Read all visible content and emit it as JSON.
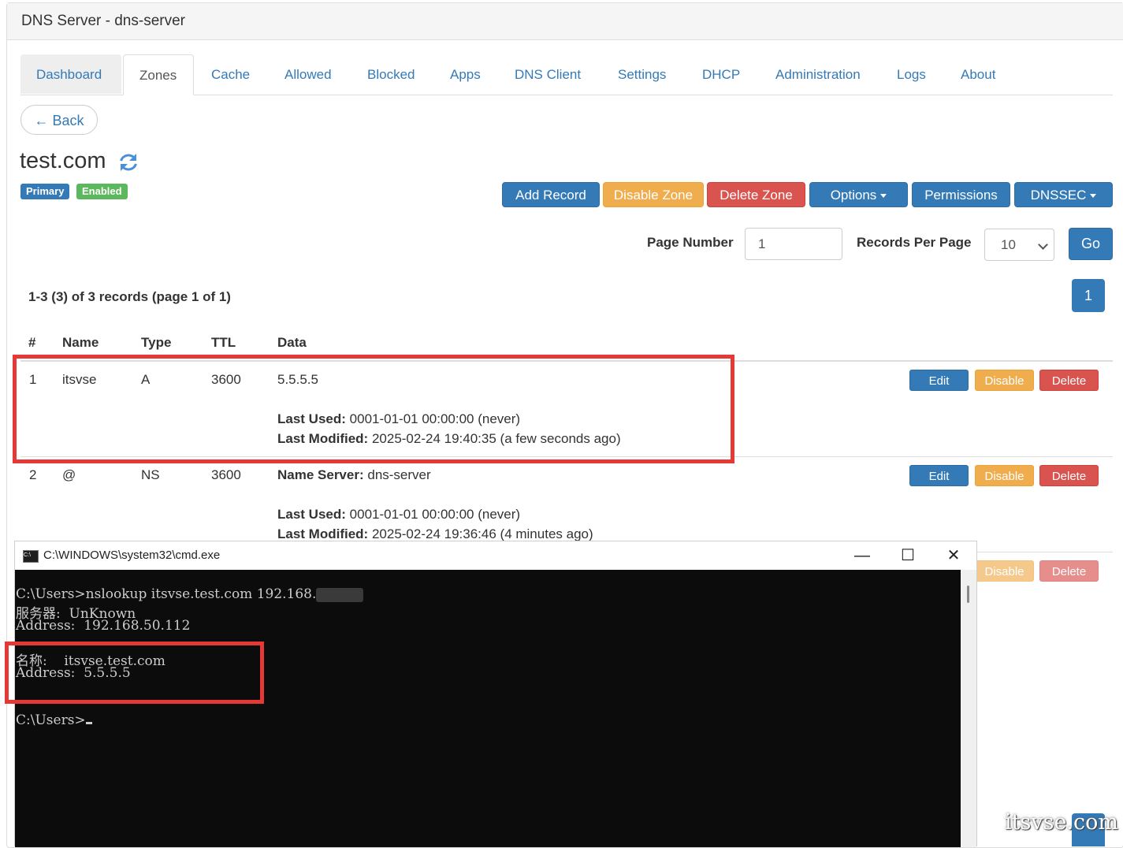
{
  "window": {
    "title": "DNS Server - dns-server"
  },
  "tabs": [
    {
      "label": "Dashboard"
    },
    {
      "label": "Zones"
    },
    {
      "label": "Cache"
    },
    {
      "label": "Allowed"
    },
    {
      "label": "Blocked"
    },
    {
      "label": "Apps"
    },
    {
      "label": "DNS Client"
    },
    {
      "label": "Settings"
    },
    {
      "label": "DHCP"
    },
    {
      "label": "Administration"
    },
    {
      "label": "Logs"
    },
    {
      "label": "About"
    }
  ],
  "back_label": "← Back",
  "zone": {
    "name": "test.com",
    "badges": {
      "type": "Primary",
      "status": "Enabled"
    },
    "colors": {
      "primary_badge": "#337ab7",
      "enabled_badge": "#5cb85c"
    }
  },
  "toolbar": {
    "add_record": "Add Record",
    "disable_zone": "Disable Zone",
    "delete_zone": "Delete Zone",
    "options": "Options",
    "permissions": "Permissions",
    "dnssec": "DNSSEC"
  },
  "paging": {
    "page_number_label": "Page Number",
    "page_number_value": "1",
    "records_per_page_label": "Records Per Page",
    "records_per_page_value": "10",
    "go_label": "Go",
    "summary": "1-3 (3) of 3 records (page 1 of 1)",
    "current_page": "1"
  },
  "table": {
    "headers": {
      "num": "#",
      "name": "Name",
      "type": "Type",
      "ttl": "TTL",
      "data": "Data"
    },
    "rows": [
      {
        "num": "1",
        "name": "itsvse",
        "type": "A",
        "ttl": "3600",
        "data": "5.5.5.5",
        "last_used_label": "Last Used:",
        "last_used": "0001-01-01 00:00:00 (never)",
        "last_modified_label": "Last Modified:",
        "last_modified": "2025-02-24 19:40:35 (a few seconds ago)"
      },
      {
        "num": "2",
        "name": "@",
        "type": "NS",
        "ttl": "3600",
        "data_label": "Name Server:",
        "data": "dns-server",
        "last_used_label": "Last Used:",
        "last_used": "0001-01-01 00:00:00 (never)",
        "last_modified_label": "Last Modified:",
        "last_modified": "2025-02-24 19:36:46 (4 minutes ago)"
      }
    ],
    "actions": {
      "edit": "Edit",
      "disable": "Disable",
      "delete": "Delete"
    }
  },
  "cmd": {
    "title": "C:\\WINDOWS\\system32\\cmd.exe",
    "controls": {
      "minimize": "—",
      "maximize": "☐",
      "close": "✕"
    },
    "lines": [
      "C:\\Users>nslookup itsvse.test.com 192.168.",
      "服务器:  UnKnown",
      "Address:  192.168.50.112",
      "名称:    itsvse.test.com",
      "Address:  5.5.5.5",
      "C:\\Users>"
    ]
  },
  "watermark": "itsvse.com"
}
